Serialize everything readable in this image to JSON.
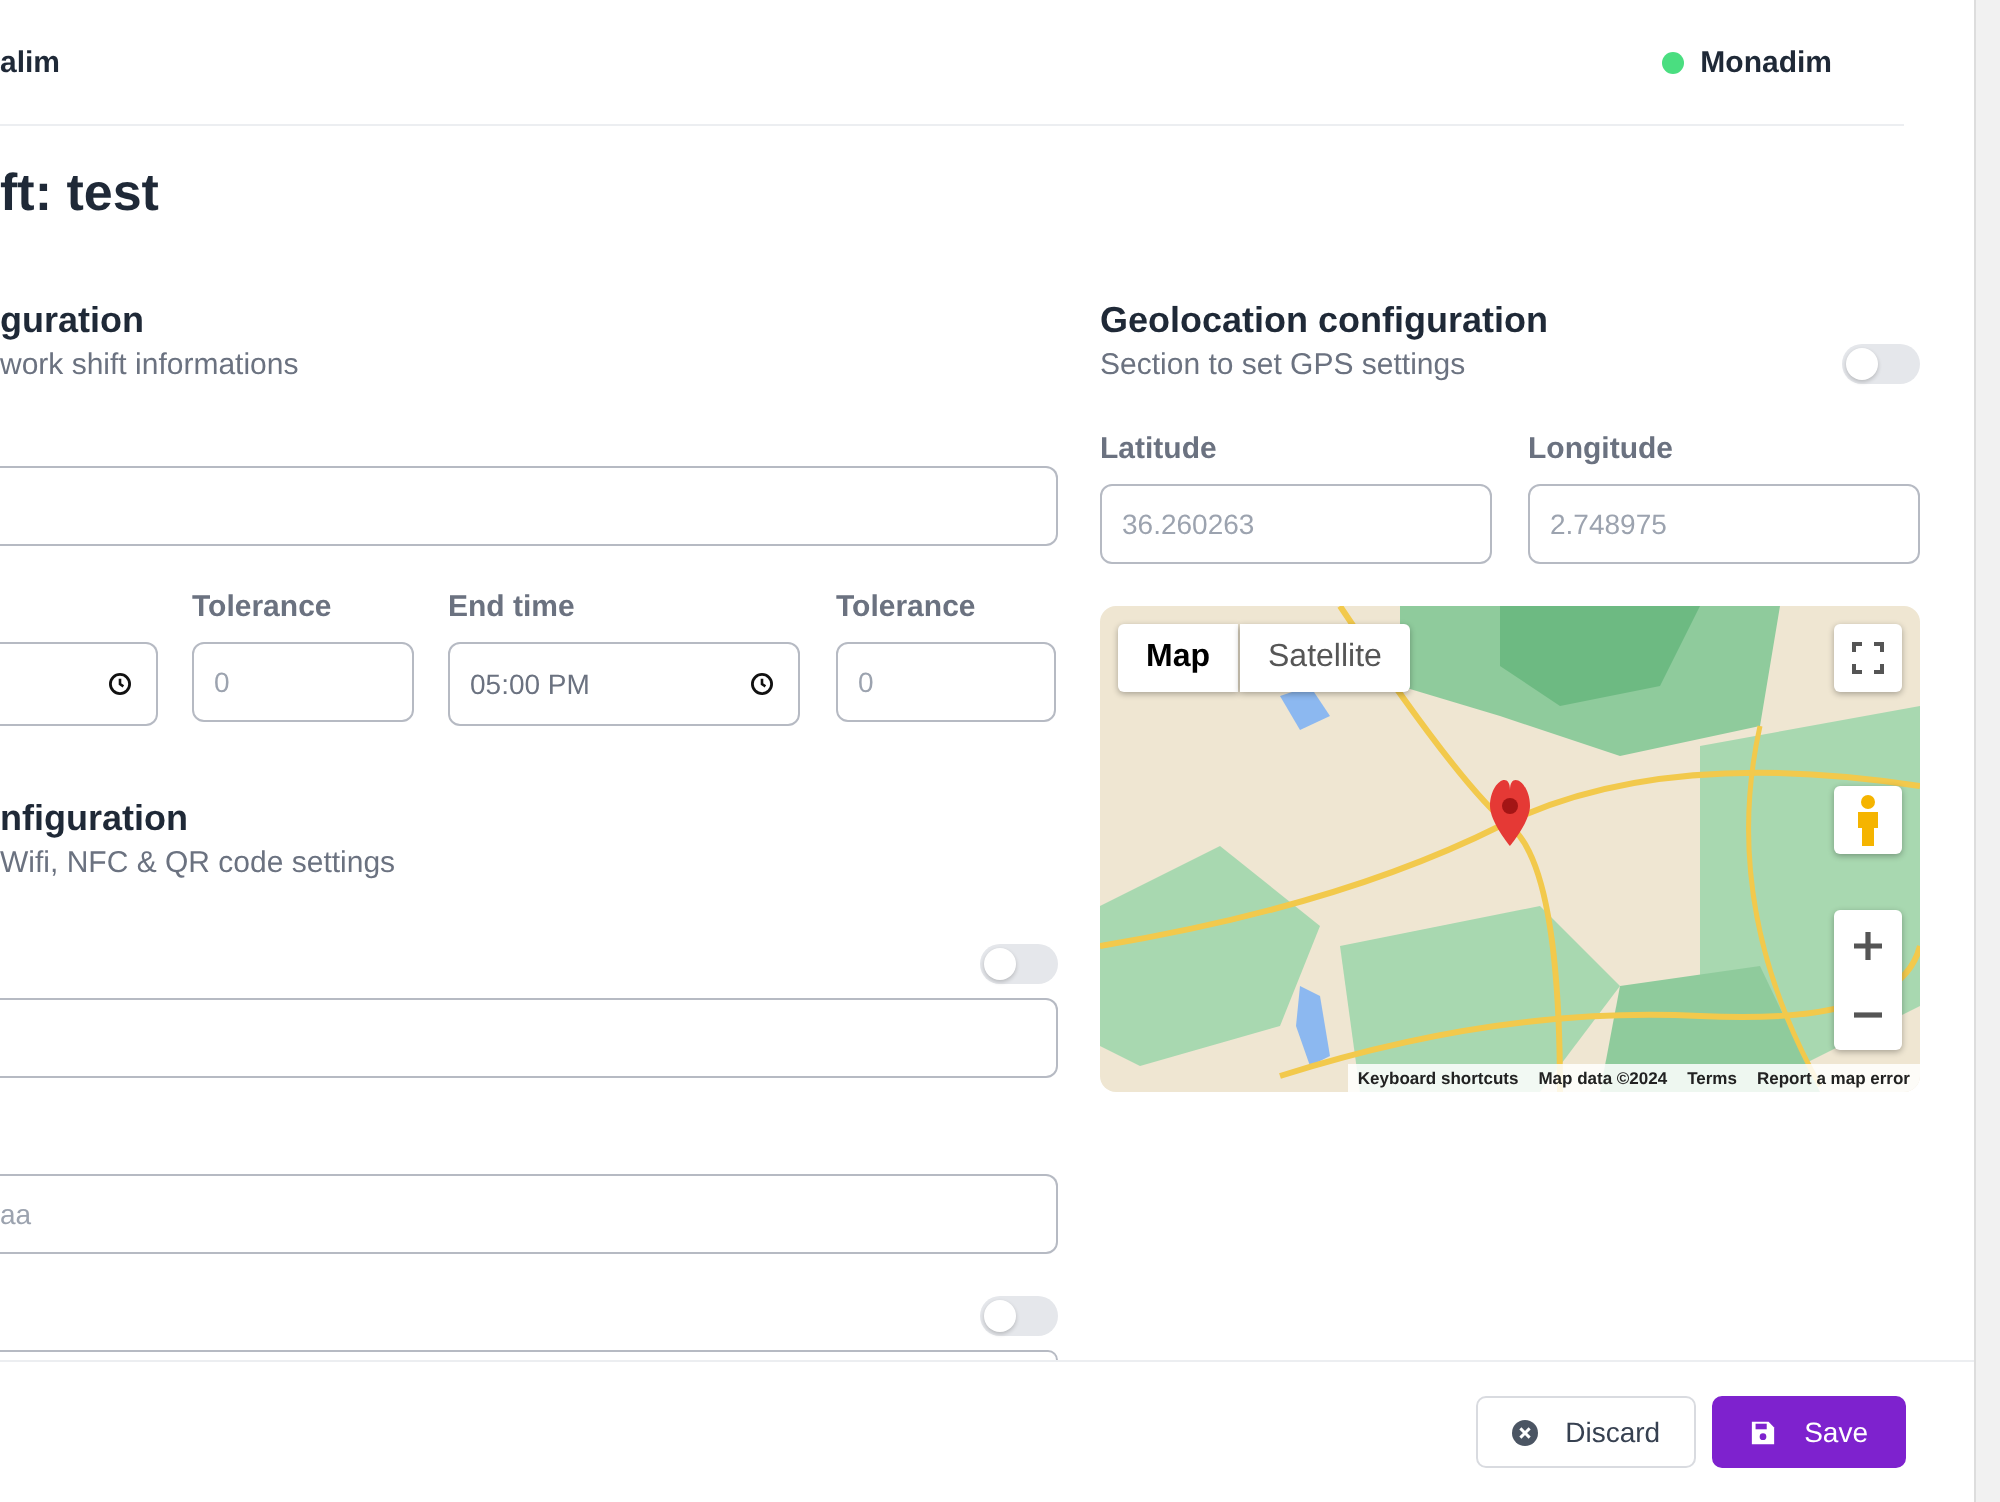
{
  "header": {
    "app_name": "alim",
    "user": {
      "name": "Monadim"
    }
  },
  "title": "ft: test",
  "general": {
    "heading": "guration",
    "description": "work shift informations",
    "time_fields": [
      {
        "kind": "time"
      },
      {
        "kind": "number",
        "label": "Tolerance",
        "placeholder": "0"
      },
      {
        "kind": "time",
        "label": "End time",
        "value": "05:00 PM"
      },
      {
        "kind": "number",
        "label": "Tolerance",
        "placeholder": "0"
      }
    ]
  },
  "pointing": {
    "heading": "nfiguration",
    "description": "Wifi, NFC & QR code settings",
    "groups": [
      {
        "kind": "toggle",
        "on": false
      },
      {
        "kind": "plain",
        "placeholder": "aa"
      },
      {
        "kind": "toggle",
        "on": false
      }
    ]
  },
  "geolocation": {
    "heading": "Geolocation configuration",
    "description": "Section to set GPS settings",
    "on": false,
    "latitude": {
      "label": "Latitude",
      "placeholder": "36.260263"
    },
    "longitude": {
      "label": "Longitude",
      "placeholder": "2.748975"
    },
    "map": {
      "kind": "picture",
      "map_types": [
        {
          "label": "Map",
          "selected": true
        },
        {
          "label": "Satellite",
          "selected": false
        }
      ],
      "attribution": [
        "Keyboard shortcuts",
        "Map data ©2024",
        "Terms",
        "Report a map error"
      ]
    }
  },
  "footer": {
    "buttons": [
      {
        "kind": "secondary",
        "label": "Discard"
      },
      {
        "kind": "primary",
        "label": "Save"
      }
    ]
  }
}
